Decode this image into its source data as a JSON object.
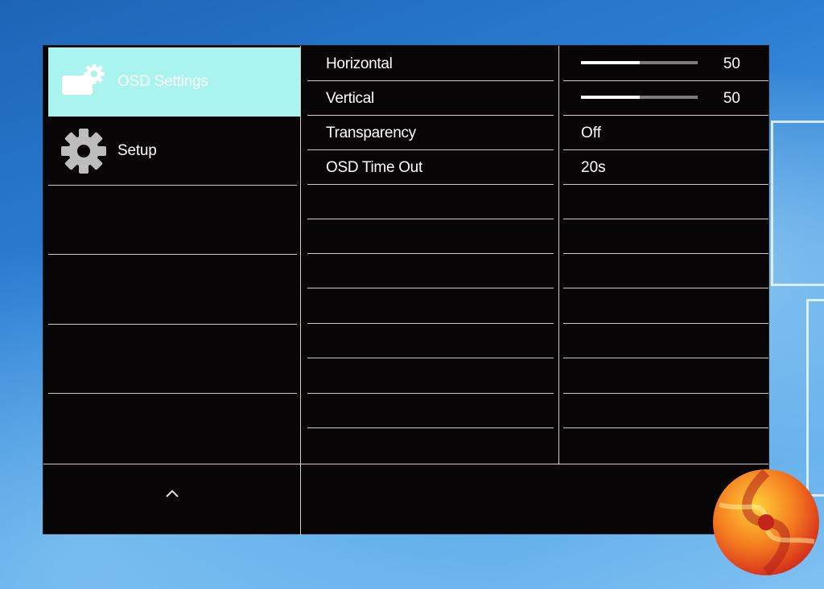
{
  "menu": {
    "items": [
      {
        "label": "OSD Settings",
        "icon": "osd-settings-icon",
        "selected": true
      },
      {
        "label": "Setup",
        "icon": "gear-icon",
        "selected": false
      }
    ],
    "scroll_up_icon": "^"
  },
  "settings": [
    {
      "label": "Horizontal",
      "type": "slider",
      "value": "50",
      "level": 0.5
    },
    {
      "label": "Vertical",
      "type": "slider",
      "value": "50",
      "level": 0.5
    },
    {
      "label": "Transparency",
      "type": "text",
      "value": "Off"
    },
    {
      "label": "OSD Time Out",
      "type": "text",
      "value": "20s"
    }
  ],
  "colors": {
    "selected_item_bg": "#a9f4ee",
    "panel_bg": "#070505",
    "divider": "#d7c6c6",
    "desktop_blue": "#2b7ed3"
  }
}
